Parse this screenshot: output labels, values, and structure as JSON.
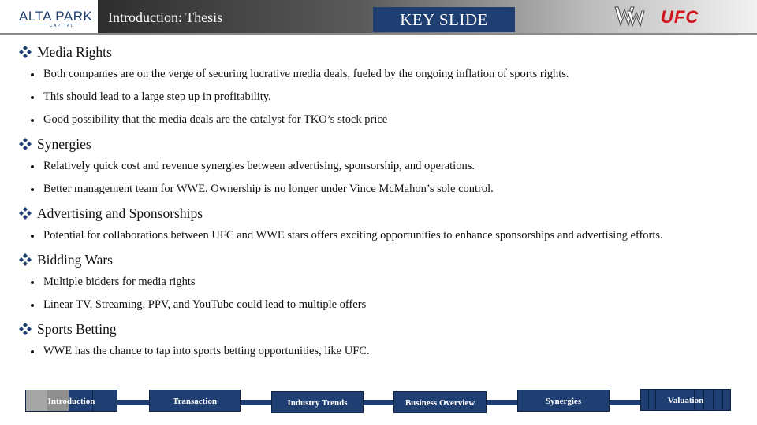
{
  "header": {
    "logo_main": "ALTA PARK",
    "logo_sub": "CAPITAL",
    "title": "Introduction: Thesis",
    "key_slide": "KEY SLIDE",
    "brand_ufc": "UFC",
    "brand_wwe_icon": "wwe-logo-icon"
  },
  "sections": [
    {
      "title": "Media Rights",
      "bullets": [
        "Both companies are on the verge of securing lucrative media deals, fueled by the ongoing inflation of sports rights.",
        "This should lead to a large step up in profitability.",
        "Good possibility that the media deals are the catalyst for TKO’s stock price"
      ]
    },
    {
      "title": "Synergies",
      "bullets": [
        "Relatively quick cost and revenue synergies between advertising, sponsorship, and operations.",
        "Better management team for WWE. Ownership is no longer under Vince McMahon’s sole control."
      ]
    },
    {
      "title": "Advertising and Sponsorships",
      "bullets": [
        "Potential for collaborations between UFC and WWE stars offers exciting opportunities to enhance sponsorships and advertising efforts."
      ]
    },
    {
      "title": "Bidding Wars",
      "bullets": [
        "Multiple bidders for media rights",
        "Linear TV, Streaming, PPV, and YouTube could lead to multiple offers"
      ]
    },
    {
      "title": "Sports Betting",
      "bullets": [
        "WWE has the chance to tap into sports betting opportunities, like UFC."
      ]
    }
  ],
  "nav": {
    "items": [
      "Introduction",
      "Transaction",
      "Industry Trends",
      "Business Overview",
      "Synergies",
      "Valuation"
    ]
  },
  "colors": {
    "accent_navy": "#1f3f73",
    "ufc_red": "#d0161c",
    "diamond_blue": "#1f3f73"
  }
}
